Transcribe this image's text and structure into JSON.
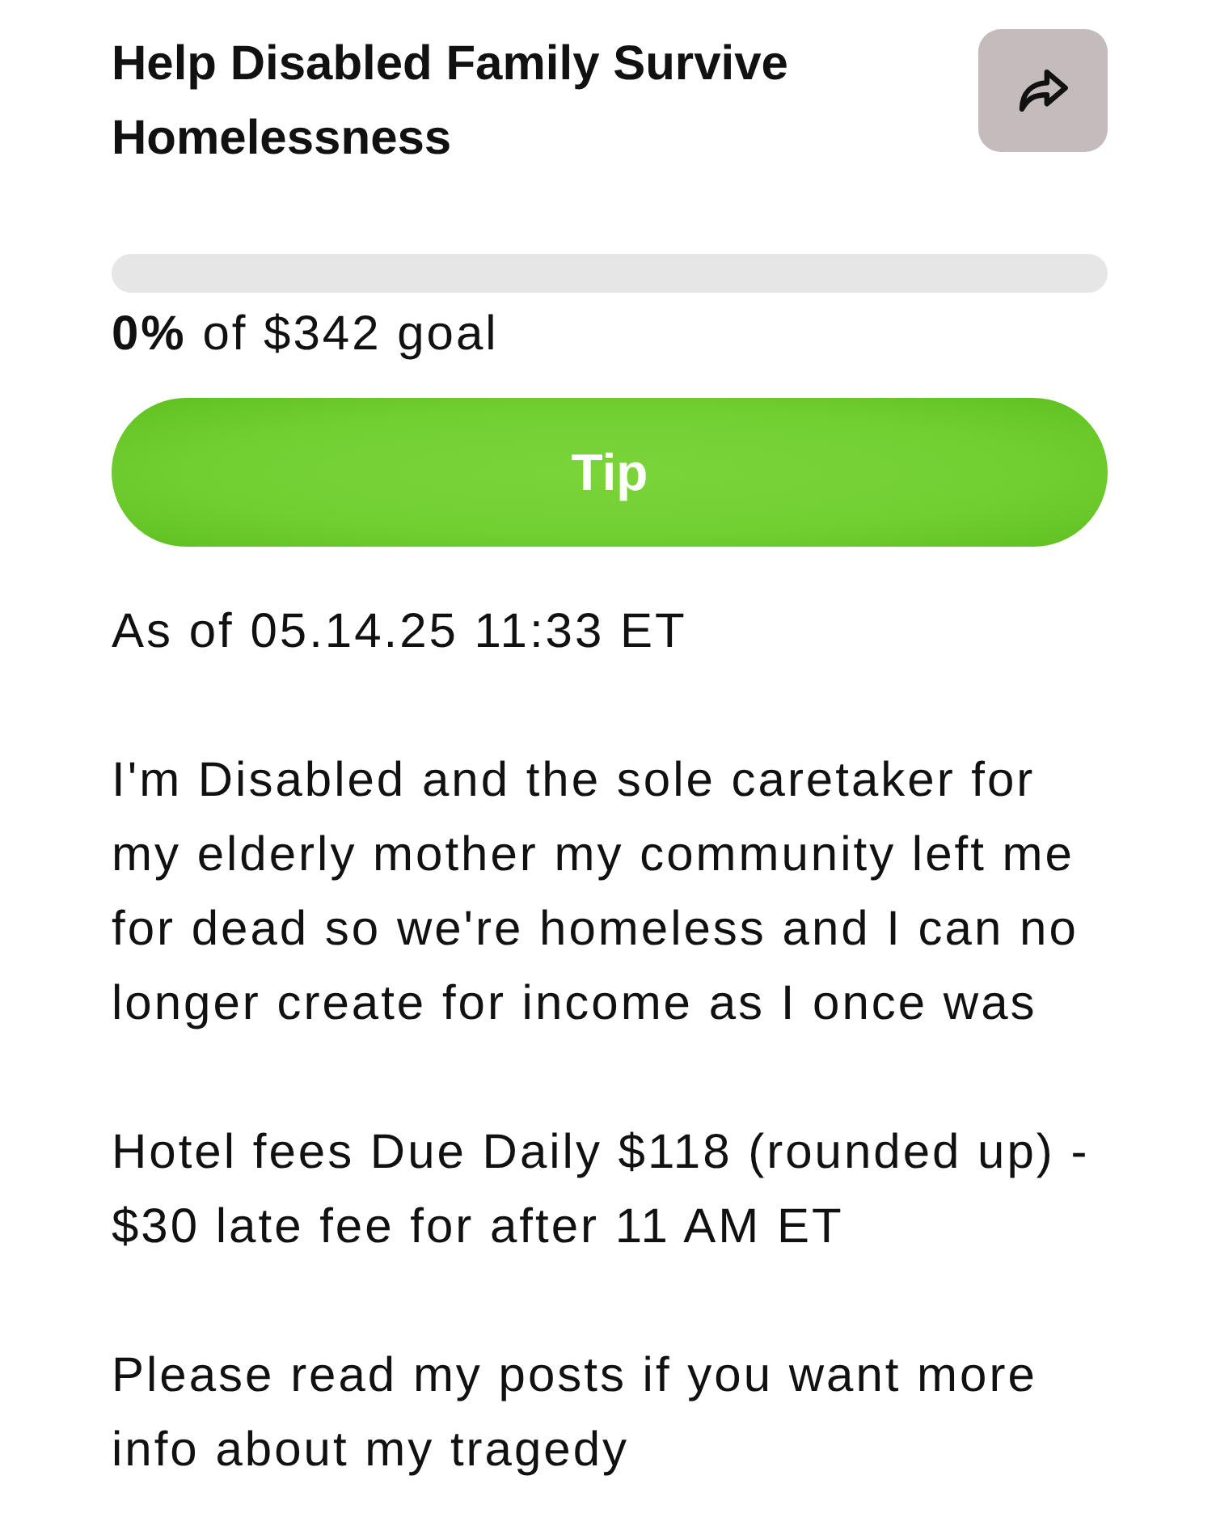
{
  "title": "Help Disabled Family Survive Homelessness",
  "progress": {
    "summary": "**0%** of $342 goal"
  },
  "tip_button": "Tip",
  "updated": "As of 05.14.25 11:33 ET",
  "description": [
    "I'm Disabled and the sole caretaker for my elderly mother my community left me for dead so we're homeless and I can no longer create for income as I once was",
    "Hotel fees Due Daily $118 (rounded up) - $30 late fee for after 11 AM ET",
    "Please read my posts if you want more info about my tragedy"
  ]
}
